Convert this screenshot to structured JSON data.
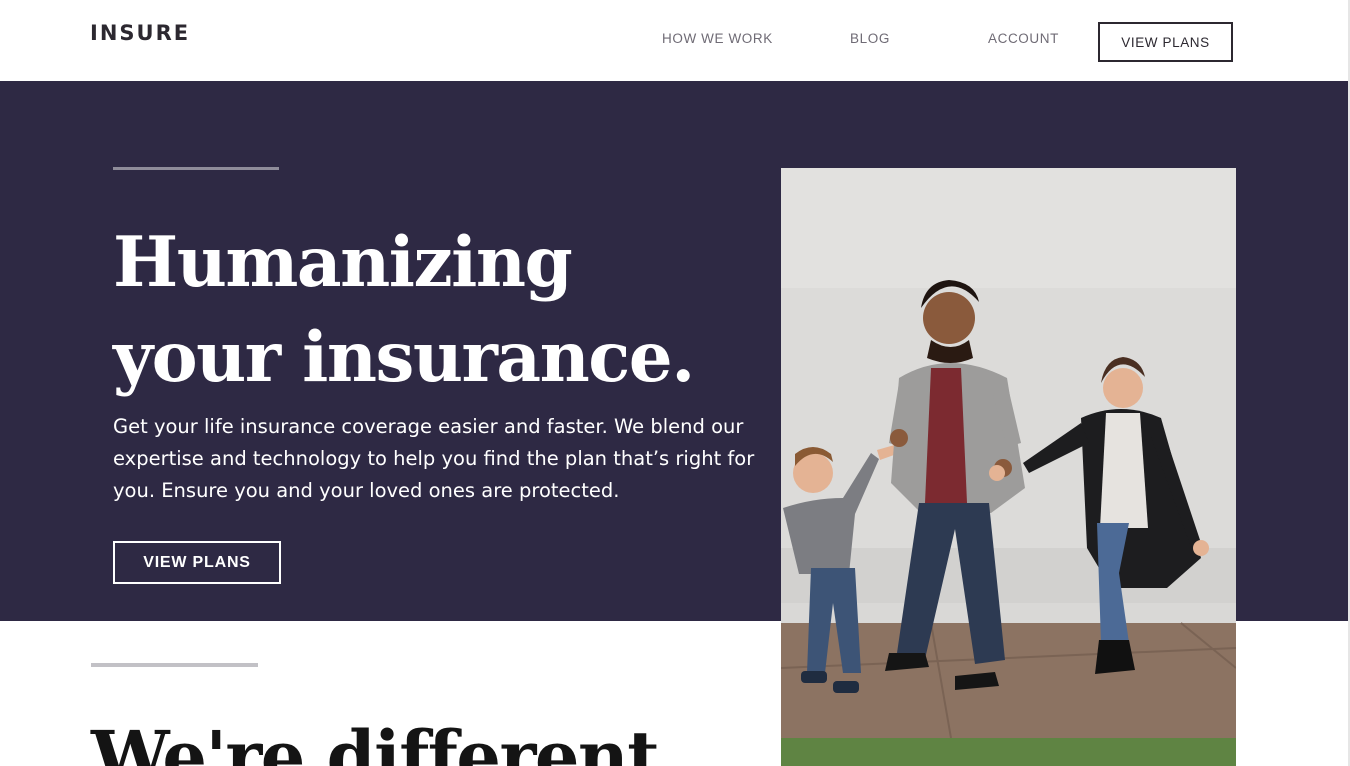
{
  "header": {
    "logo": "INSURE",
    "nav": {
      "how_we_work": "HOW WE WORK",
      "blog": "BLOG",
      "account": "ACCOUNT"
    },
    "cta_label": "VIEW PLANS"
  },
  "hero": {
    "title": "Humanizing your insurance.",
    "description": "Get your life insurance coverage easier and faster. We blend our expertise and technology to help you find the plan that’s right for you. Ensure you and your loved ones are protected.",
    "cta_label": "VIEW PLANS",
    "image_icon": "family-photo"
  },
  "section": {
    "title": "We're different"
  },
  "colors": {
    "hero_bg": "#2e2944",
    "text_dark": "#2c2830",
    "nav_text": "#6f6b75",
    "white": "#ffffff"
  }
}
